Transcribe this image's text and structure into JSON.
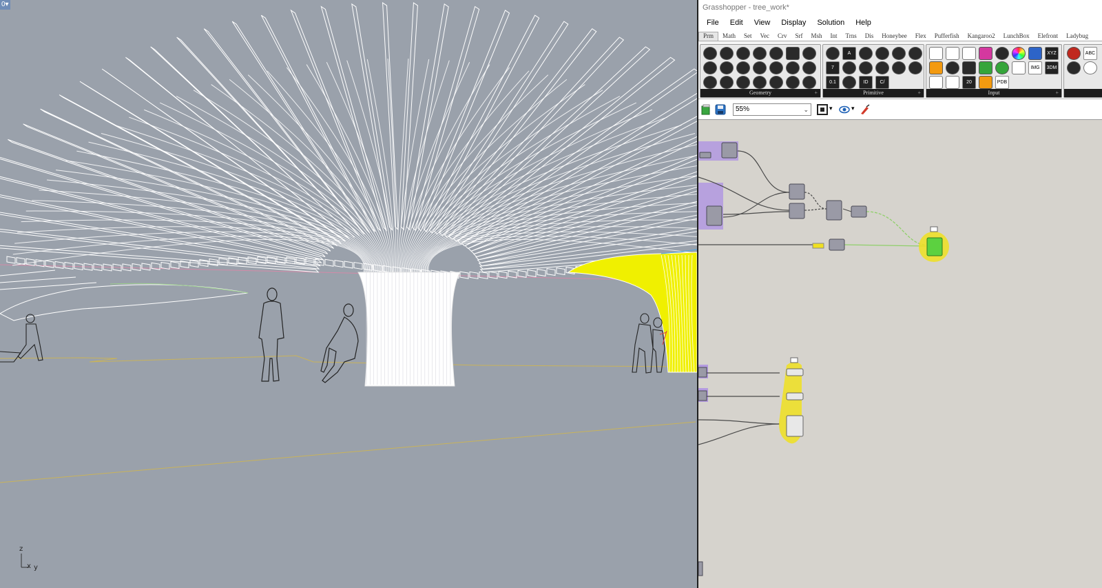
{
  "viewport": {
    "menu_label": "0▾",
    "axis": {
      "z": "z",
      "x": "x",
      "y": "y"
    }
  },
  "gh": {
    "title": "Grasshopper - tree_work*",
    "menu": [
      "File",
      "Edit",
      "View",
      "Display",
      "Solution",
      "Help"
    ],
    "tabs": [
      "Prm",
      "Math",
      "Set",
      "Vec",
      "Crv",
      "Srf",
      "Msh",
      "Int",
      "Trns",
      "Dis",
      "Honeybee",
      "Flex",
      "Pufferfish",
      "Kangaroo2",
      "LunchBox",
      "Elefront",
      "Ladybug"
    ],
    "active_tab": "Prm",
    "panels": [
      {
        "label": "Geometry"
      },
      {
        "label": "Primitive"
      },
      {
        "label": "Input"
      }
    ],
    "primitive_icons": {
      "seven": "7",
      "zero_one": "0.1",
      "id": "ID",
      "a": "A",
      "c": "C/"
    },
    "input_icons": {
      "twenty": "20",
      "xyz": "XYZ",
      "img": "IMG",
      "threedm": "3DM",
      "pdb": "PDB",
      "abc": "ABC"
    },
    "zoom": "55%",
    "colors": {
      "selected_group": "#b49be0",
      "yellow_highlight": "#f0e020",
      "panel_green": "#5cd140",
      "wire_green": "#8fcf6a"
    }
  },
  "icons": [
    "open-file-icon",
    "save-icon",
    "zoom-dropdown-icon",
    "preview-eye-icon",
    "paint-brush-icon"
  ]
}
